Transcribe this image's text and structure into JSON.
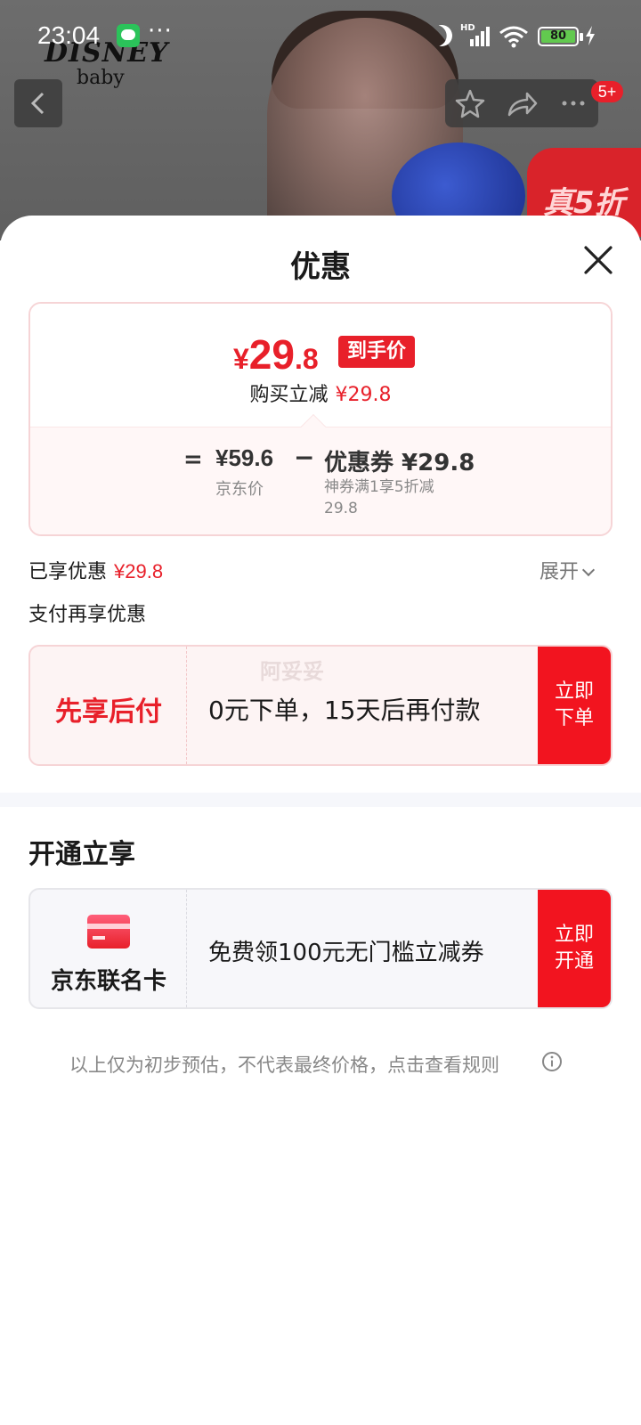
{
  "status_bar": {
    "time": "23:04",
    "more_dots": "···",
    "signal_label": "HD",
    "battery": "80"
  },
  "background": {
    "brand_logo_line1": "DISNEY",
    "brand_logo_line2": "baby",
    "promo_tag": "真5折"
  },
  "nav": {
    "notification_count": "5+"
  },
  "sheet": {
    "title": "优惠",
    "price_summary": {
      "currency_symbol": "¥",
      "final_price_int": "29",
      "final_price_dec": ".8",
      "arrival_badge": "到手价",
      "instant_discount_label": "购买立减",
      "instant_discount_value": "¥29.8",
      "equals": "=",
      "jd_price_value": "¥59.6",
      "jd_price_label": "京东价",
      "minus": "−",
      "coupon_value": "优惠券 ¥29.8",
      "coupon_desc": "神券满1享5折减29.8"
    },
    "enjoyed": {
      "label": "已享优惠",
      "value": "¥29.8",
      "expand_label": "展开"
    },
    "pay_more": {
      "title": "支付再享优惠",
      "bnpl_label": "先享后付",
      "bnpl_watermark": "阿妥妥",
      "bnpl_desc": "0元下单，15天后再付款",
      "bnpl_action": "立即下单"
    },
    "open_section": {
      "title": "开通立享",
      "card_name": "京东联名卡",
      "card_desc": "免费领100元无门槛立减券",
      "card_action": "立即开通"
    },
    "disclaimer": "以上仅为初步预估，不代表最终价格，点击查看规则"
  },
  "colors": {
    "accent_red": "#e8202a",
    "button_red": "#f2141f"
  }
}
